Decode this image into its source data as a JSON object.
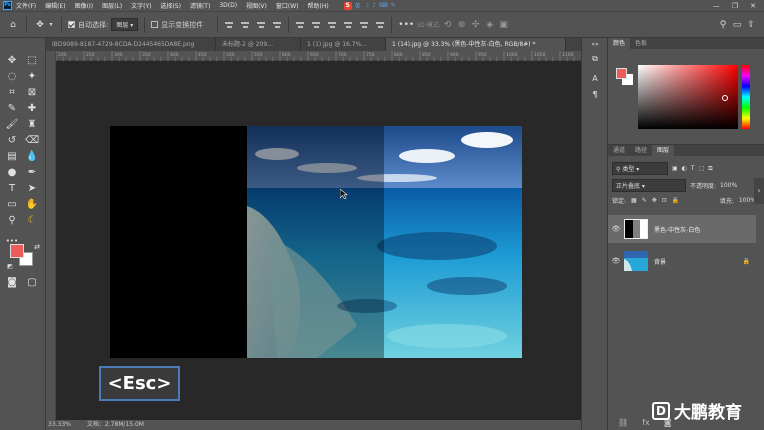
{
  "menu": {
    "logo": "Ps",
    "items": [
      "文件(F)",
      "编辑(E)",
      "图像(I)",
      "图层(L)",
      "文字(Y)",
      "选择(S)",
      "滤镜(T)",
      "3D(D)",
      "视图(V)",
      "窗口(W)",
      "帮助(H)"
    ],
    "ime": [
      "英",
      "☽",
      "♪",
      "⌨",
      "✎"
    ]
  },
  "options": {
    "auto_select_label": "自动选择:",
    "auto_select_value": "图层",
    "show_transform_label": "显示变换控件",
    "mode3d_label": "3D 模式:"
  },
  "tabs": [
    {
      "label": "IBD9089-8187-4729-8CDA-D2445465DA8E.png",
      "active": false
    },
    {
      "label": "未标题-2 @ 209...",
      "active": false
    },
    {
      "label": "1 (1).jpg @ 16.7%...",
      "active": false
    },
    {
      "label": "1 (14).jpg @ 33.3% (黑色-中性灰-白色, RGB/8#) *",
      "active": true
    }
  ],
  "ruler_labels": [
    "200",
    "250",
    "300",
    "350",
    "400",
    "450",
    "500",
    "550",
    "600",
    "650",
    "700",
    "750",
    "800",
    "850",
    "900",
    "950",
    "1000",
    "1050",
    "1100"
  ],
  "esc_label": "<Esc>",
  "status": {
    "zoom": "33.33%",
    "doc": "文档：2.78M/15.0M"
  },
  "color_panel": {
    "tabs": [
      "颜色",
      "色板"
    ],
    "fg_color": "#ee5b5b",
    "bg_color": "#ffffff"
  },
  "layers_panel": {
    "tabs": [
      "通道",
      "路径",
      "图层"
    ],
    "kind_filter": "类型",
    "blend_mode": "正片叠底",
    "opacity_label": "不透明度:",
    "opacity_value": "100%",
    "lock_label": "锁定:",
    "fill_label": "填充:",
    "fill_value": "100%",
    "layers": [
      {
        "name": "黑色-中性灰-白色",
        "selected": true
      },
      {
        "name": "背景",
        "selected": false
      }
    ]
  },
  "watermark": {
    "text": "大鹏教育"
  }
}
